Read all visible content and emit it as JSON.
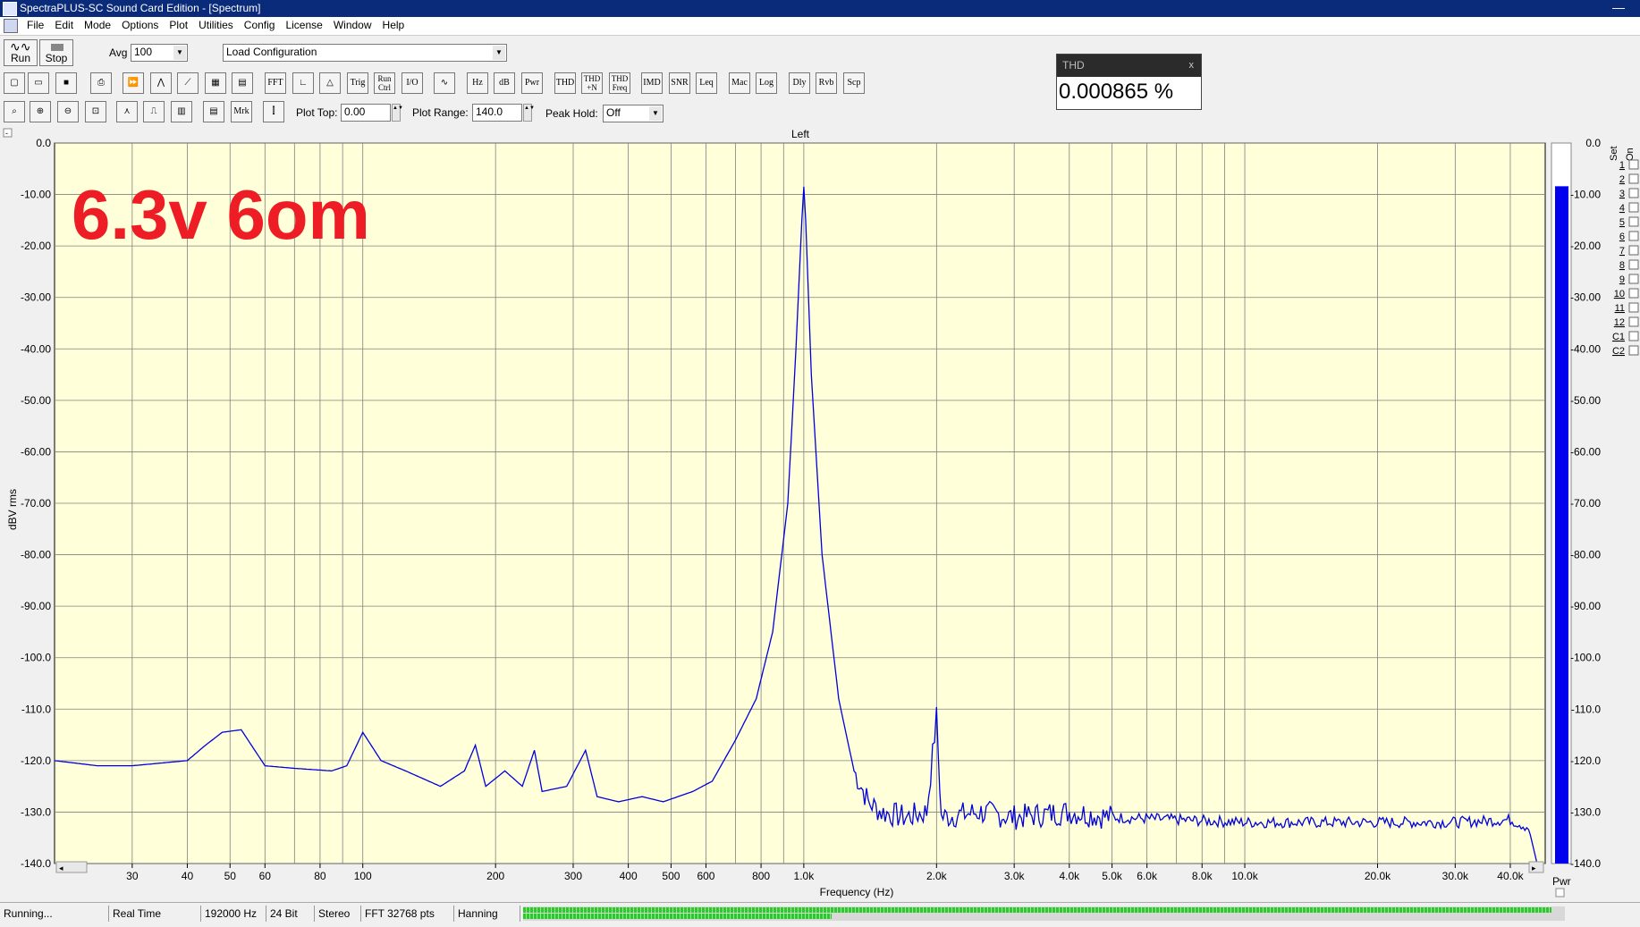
{
  "window": {
    "title": "SpectraPLUS-SC Sound Card Edition - [Spectrum]",
    "minimize": "—"
  },
  "menu": [
    "File",
    "Edit",
    "Mode",
    "Options",
    "Plot",
    "Utilities",
    "Config",
    "License",
    "Window",
    "Help"
  ],
  "toolbar1": {
    "run_label": "Run",
    "stop_label": "Stop",
    "avg_label": "Avg",
    "avg_value": "100",
    "config_value": "Load Configuration"
  },
  "toolbar2": {
    "buttons": [
      "FFT",
      "Trig",
      "Run Ctrl",
      "I/O",
      "Hz",
      "dB",
      "Pwr",
      "THD",
      "THD +N",
      "THD Freq",
      "IMD",
      "SNR",
      "Leq",
      "Mac",
      "Log",
      "Dly",
      "Rvb",
      "Scp"
    ]
  },
  "toolbar3": {
    "mrk_label": "Mrk",
    "plot_top_label": "Plot Top:",
    "plot_top_value": "0.00",
    "plot_range_label": "Plot Range:",
    "plot_range_value": "140.0",
    "peak_hold_label": "Peak Hold:",
    "peak_hold_value": "Off"
  },
  "thd_panel": {
    "title": "THD",
    "close": "x",
    "value": "0.000865 %"
  },
  "plot": {
    "channel": "Left",
    "overlay_text": "6.3v 6om",
    "pwr_label": "Pwr",
    "level_fraction": 0.94,
    "set_label": "Set",
    "on_label": "On",
    "sets": [
      "1",
      "2",
      "3",
      "4",
      "5",
      "6",
      "7",
      "8",
      "9",
      "10",
      "11",
      "12",
      "C1",
      "C2"
    ],
    "colors": {
      "plot_bg": "#ffffd9",
      "trace": "#0000dd",
      "overlay": "#ee1c25",
      "meter": "#0000ee"
    }
  },
  "chart_data": {
    "type": "line",
    "xlabel": "Frequency (Hz)",
    "ylabel": "dBV rms",
    "xscale": "log",
    "xlim": [
      20,
      48000
    ],
    "ylim": [
      -140,
      0
    ],
    "x_ticks": [
      "30",
      "40",
      "50",
      "60",
      "80",
      "100",
      "200",
      "300",
      "400",
      "500",
      "600",
      "800",
      "1.0k",
      "2.0k",
      "3.0k",
      "4.0k",
      "5.0k",
      "6.0k",
      "8.0k",
      "10.0k",
      "20.0k",
      "30.0k",
      "40.0k"
    ],
    "y_ticks": [
      "0.0",
      "-10.00",
      "-20.00",
      "-30.00",
      "-40.00",
      "-50.00",
      "-60.00",
      "-70.00",
      "-80.00",
      "-90.00",
      "-100.0",
      "-110.0",
      "-120.0",
      "-130.0",
      "-140.0"
    ],
    "series": [
      {
        "points": [
          [
            20,
            -120
          ],
          [
            25,
            -121
          ],
          [
            30,
            -121
          ],
          [
            40,
            -120
          ],
          [
            44,
            -117
          ],
          [
            48,
            -114.5
          ],
          [
            53,
            -114
          ],
          [
            60,
            -121
          ],
          [
            70,
            -121.5
          ],
          [
            85,
            -122
          ],
          [
            92,
            -121
          ],
          [
            100,
            -114.5
          ],
          [
            110,
            -120
          ],
          [
            125,
            -122
          ],
          [
            150,
            -125
          ],
          [
            170,
            -122
          ],
          [
            180,
            -117
          ],
          [
            190,
            -125
          ],
          [
            210,
            -122
          ],
          [
            230,
            -125
          ],
          [
            245,
            -118
          ],
          [
            255,
            -126
          ],
          [
            290,
            -125
          ],
          [
            320,
            -118
          ],
          [
            340,
            -127
          ],
          [
            380,
            -128
          ],
          [
            430,
            -127
          ],
          [
            480,
            -128
          ],
          [
            560,
            -126
          ],
          [
            620,
            -124
          ],
          [
            700,
            -116
          ],
          [
            780,
            -108
          ],
          [
            850,
            -95
          ],
          [
            920,
            -70
          ],
          [
            960,
            -40
          ],
          [
            990,
            -15
          ],
          [
            1000,
            -8.5
          ],
          [
            1010,
            -15
          ],
          [
            1040,
            -45
          ],
          [
            1100,
            -80
          ],
          [
            1200,
            -108
          ],
          [
            1300,
            -122
          ],
          [
            1400,
            -128
          ],
          [
            1500,
            -130
          ],
          [
            1700,
            -131
          ],
          [
            1900,
            -130
          ],
          [
            2000,
            -111.5
          ],
          [
            2050,
            -131
          ],
          [
            2500,
            -130
          ],
          [
            3000,
            -131
          ],
          [
            4000,
            -130
          ],
          [
            5000,
            -131
          ],
          [
            10000,
            -132
          ],
          [
            20000,
            -132
          ],
          [
            30000,
            -132
          ],
          [
            40000,
            -131.5
          ],
          [
            44000,
            -133
          ],
          [
            46000,
            -140
          ]
        ]
      }
    ]
  }
}
